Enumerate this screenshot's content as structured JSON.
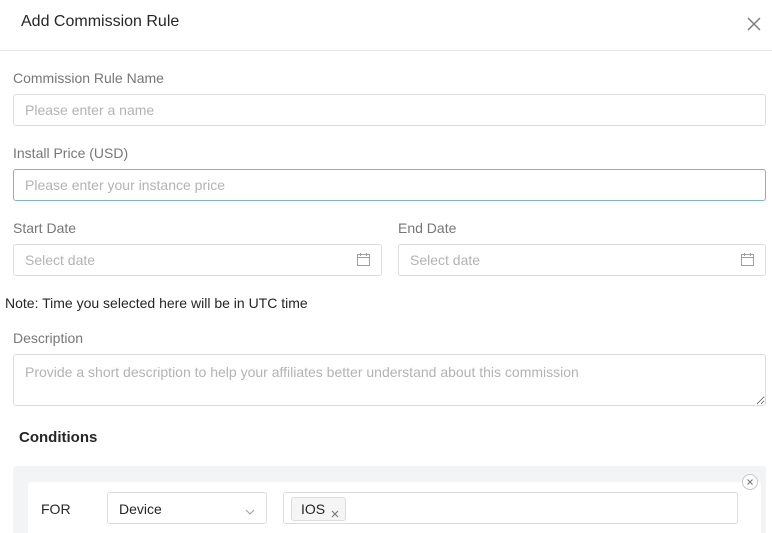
{
  "dialog": {
    "title": "Add Commission Rule",
    "close_icon": "close-icon"
  },
  "form": {
    "rule_name": {
      "label": "Commission Rule Name",
      "placeholder": "Please enter a name",
      "value": ""
    },
    "install_price": {
      "label": "Install Price (USD)",
      "placeholder": "Please enter your instance price",
      "value": ""
    },
    "start_date": {
      "label": "Start Date",
      "placeholder": "Select date",
      "icon": "calendar-icon"
    },
    "end_date": {
      "label": "End Date",
      "placeholder": "Select date",
      "icon": "calendar-icon"
    },
    "note": "Note: Time you selected here will be in UTC time",
    "description": {
      "label": "Description",
      "placeholder": "Provide a short description to help your affiliates better understand about this commission"
    }
  },
  "conditions": {
    "title": "Conditions",
    "rows": [
      {
        "for_label": "FOR",
        "field": "Device",
        "tags": [
          "IOS"
        ]
      }
    ]
  },
  "colors": {
    "focus_border": "#7fb6bf",
    "panel_bg": "#f3f4f6",
    "border": "#dcdcdc"
  }
}
